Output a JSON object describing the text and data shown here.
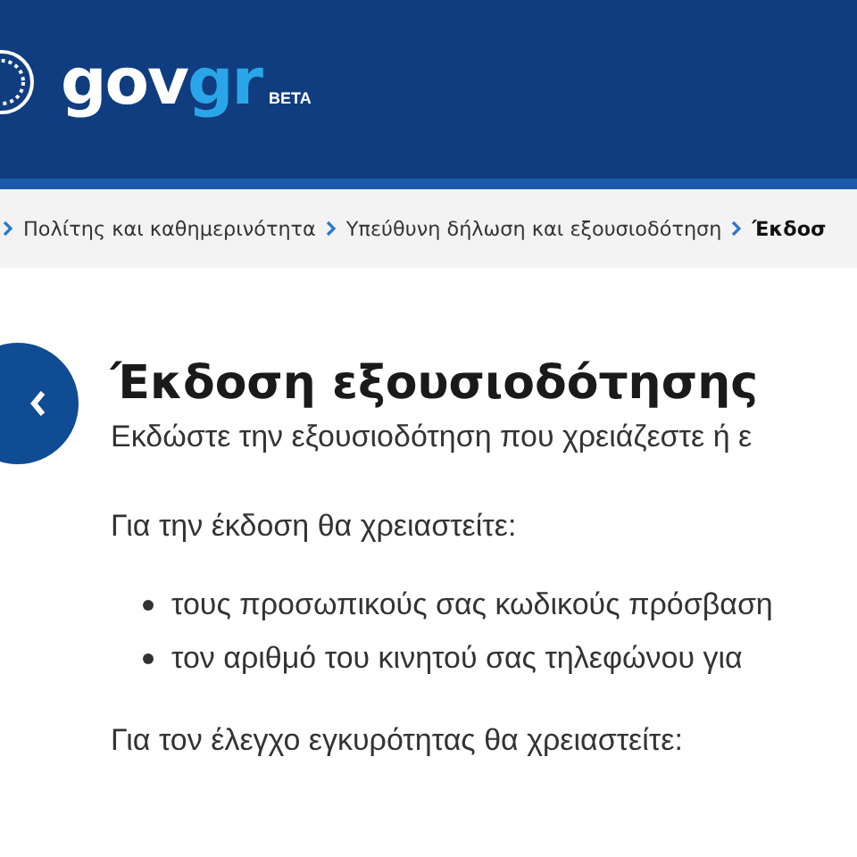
{
  "header": {
    "logo": {
      "text": "gov",
      "accent": "gr"
    },
    "badge": "BETA"
  },
  "breadcrumb": [
    {
      "label": "Πολίτης και καθημερινότητα",
      "current": false
    },
    {
      "label": "Υπεύθυνη δήλωση και εξουσιοδότηση",
      "current": false
    },
    {
      "label": "Έκδοσ",
      "current": true
    }
  ],
  "title": "Έκδοση εξουσιοδότησης",
  "subtitle": "Εκδώστε την εξουσιοδότηση που χρειάζεστε ή ε",
  "issue_intro": "Για την έκδοση θα χρειαστείτε:",
  "issue_requirements": [
    "τους προσωπικούς σας κωδικούς πρόσβαση",
    "τον αριθμό του κινητού σας τηλεφώνου για"
  ],
  "validation_intro": "Για τον έλεγχο εγκυρότητας θα χρειαστείτε:"
}
